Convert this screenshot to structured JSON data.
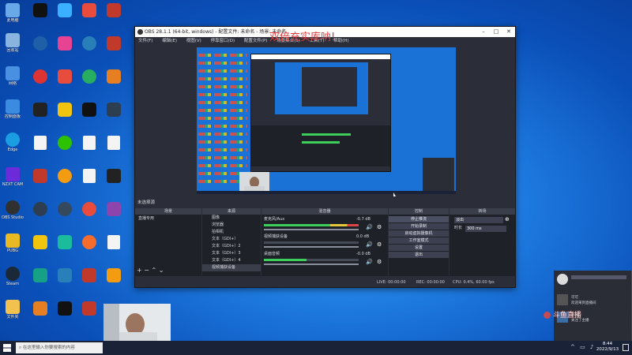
{
  "desktop": {
    "icons": [
      {
        "label": "此电脑",
        "color": "#6aa9e8"
      },
      {
        "label": "回收站",
        "color": "#89b4e0"
      },
      {
        "label": "网络",
        "color": "#4a90e2"
      },
      {
        "label": "控制面板",
        "color": "#3b8be0"
      },
      {
        "label": "AIDA64",
        "color": "#c0392b"
      },
      {
        "label": "Edge",
        "color": "#1b9de2"
      },
      {
        "label": "NZXT CAM",
        "color": "#6c2bd9"
      },
      {
        "label": "OBS Studio",
        "color": "#303030"
      },
      {
        "label": "PUBG",
        "color": "#e8b923"
      },
      {
        "label": "Steam",
        "color": "#1b2838"
      },
      {
        "label": "文件夹",
        "color": "#f2c14e"
      },
      {
        "label": "QQ",
        "color": "#111"
      },
      {
        "label": "鲁大师",
        "color": "#1f5fa8"
      },
      {
        "label": "网易云音乐",
        "color": "#d33"
      },
      {
        "label": "微信",
        "color": "#2dc100"
      },
      {
        "label": "Origin",
        "color": "#f56c2d"
      },
      {
        "label": "UU加速器",
        "color": "#1a73e8"
      }
    ]
  },
  "obs": {
    "title": "OBS 28.1.1 (64-bit, windows) - 配置文件: 未命名 - 场景: 未命名",
    "menu": [
      "文件(F)",
      "编辑(E)",
      "视图(V)",
      "停靠窗口(D)",
      "配置文件(P)",
      "场景集合(S)",
      "工具(T)",
      "帮助(H)"
    ],
    "scene_label": "未选择源",
    "docks": {
      "scenes": "场景",
      "sources": "来源",
      "mixer": "混音器",
      "transitions": "转场",
      "controls": "控制"
    },
    "scenes": [
      "直播专用"
    ],
    "sources": [
      "图像",
      "浏览器",
      "拍相机",
      "文本（GDI+）",
      "文本（GDI+）2",
      "文本（GDI+）3",
      "文本（GDI+）4",
      "视频捕获设备"
    ],
    "mixer": [
      {
        "name": "麦克风/Aux",
        "db": "-0.7 dB"
      },
      {
        "name": "视频捕获设备",
        "db": "0.0 dB"
      },
      {
        "name": "桌面音频",
        "db": "-0.0 dB"
      }
    ],
    "controls": [
      "停止推流",
      "开始录制",
      "启动虚拟摄像机",
      "工作室模式",
      "设置",
      "退出"
    ],
    "transition": {
      "name": "淡出",
      "duration_label": "时长",
      "duration": "300 ms"
    },
    "status": {
      "live": "LIVE: 00:00:00",
      "rec": "REC: 00:00:00",
      "cpu": "CPU: 0.4%, 60.00 fps"
    }
  },
  "overlay_text": "双倍充实库呐!",
  "taskbar": {
    "search_placeholder": "在这里输入你要搜索的内容",
    "time": "8:44",
    "date": "2022/9/13"
  },
  "notifications": [
    {
      "title": "可可",
      "text": "欢迎来到直播间"
    },
    {
      "title": "留言",
      "text": "主播在玩什么"
    },
    {
      "title": "小嘉人",
      "text": "关注了主播"
    }
  ],
  "watermark": "斗鱼直播"
}
